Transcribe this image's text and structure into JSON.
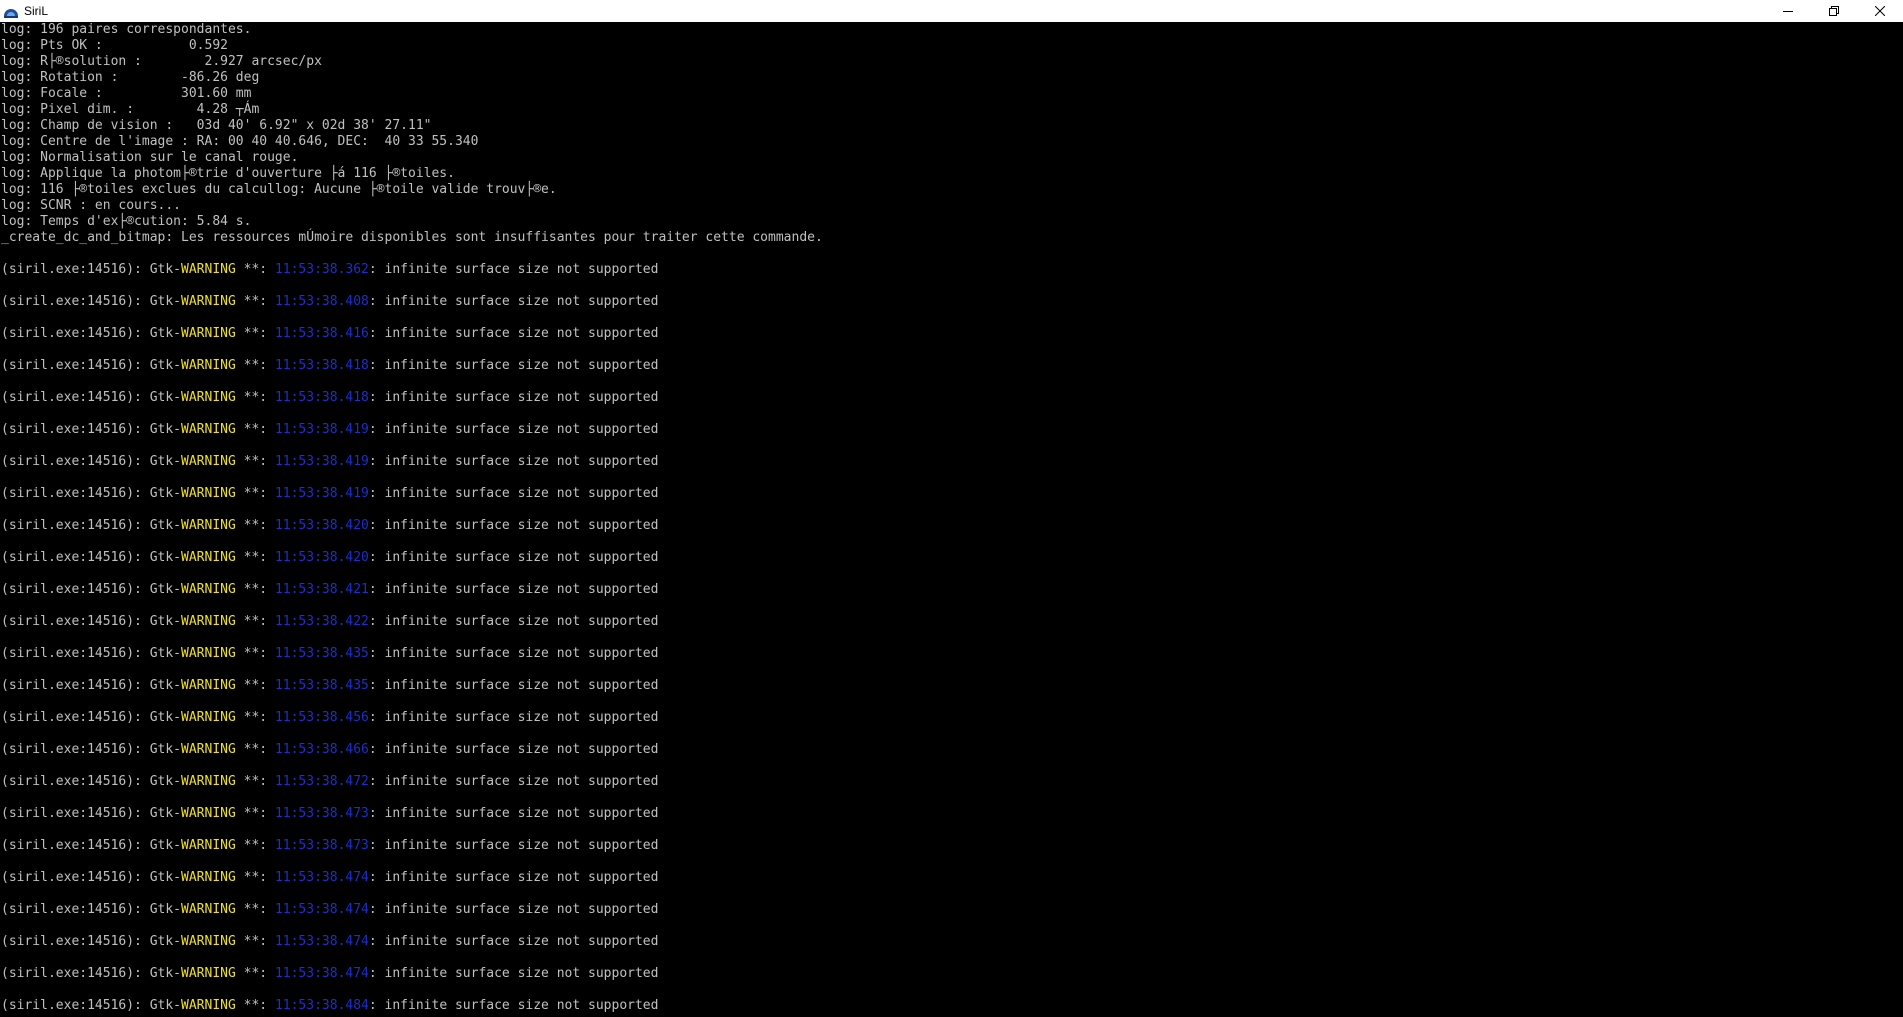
{
  "window": {
    "title": "SiriL",
    "icon": "siril-app-icon",
    "controls": [
      "minimize-icon",
      "restore-icon",
      "close-icon"
    ]
  },
  "colors": {
    "background": "#000000",
    "text": "#c0c0c0",
    "warning": "#f2e01a",
    "timestamp": "#1a2fd0",
    "titlebar": "#ffffff"
  },
  "log_lines": [
    "log: 196 paires correspondantes.",
    "log: Pts OK :           0.592",
    "log: R├®solution :        2.927 arcsec/px",
    "log: Rotation :        -86.26 deg",
    "log: Focale :          301.60 mm",
    "log: Pixel dim. :        4.28 ┬Ám",
    "log: Champ de vision :   03d 40' 6.92\" x 02d 38' 27.11\"",
    "log: Centre de l'image : RA: 00 40 40.646, DEC:  40 33 55.340",
    "log: Normalisation sur le canal rouge.",
    "log: Applique la photom├®trie d'ouverture ├á 116 ├®toiles.",
    "log: 116 ├®toiles exclues du calcullog: Aucune ├®toile valide trouv├®e.",
    "log: SCNR : en cours...",
    "log: Temps d'ex├®cution: 5.84 s.",
    "_create_dc_and_bitmap: Les ressources mÚmoire disponibles sont insuffisantes pour traiter cette commande."
  ],
  "warning_line": {
    "prefix": "(siril.exe:14516): Gtk-",
    "level": "WARNING",
    "separator": " **: ",
    "message": ": infinite surface size not supported"
  },
  "warning_timestamps": [
    "11:53:38.362",
    "11:53:38.408",
    "11:53:38.416",
    "11:53:38.418",
    "11:53:38.418",
    "11:53:38.419",
    "11:53:38.419",
    "11:53:38.419",
    "11:53:38.420",
    "11:53:38.420",
    "11:53:38.421",
    "11:53:38.422",
    "11:53:38.435",
    "11:53:38.435",
    "11:53:38.456",
    "11:53:38.466",
    "11:53:38.472",
    "11:53:38.473",
    "11:53:38.473",
    "11:53:38.474",
    "11:53:38.474",
    "11:53:38.474",
    "11:53:38.474",
    "11:53:38.484"
  ]
}
